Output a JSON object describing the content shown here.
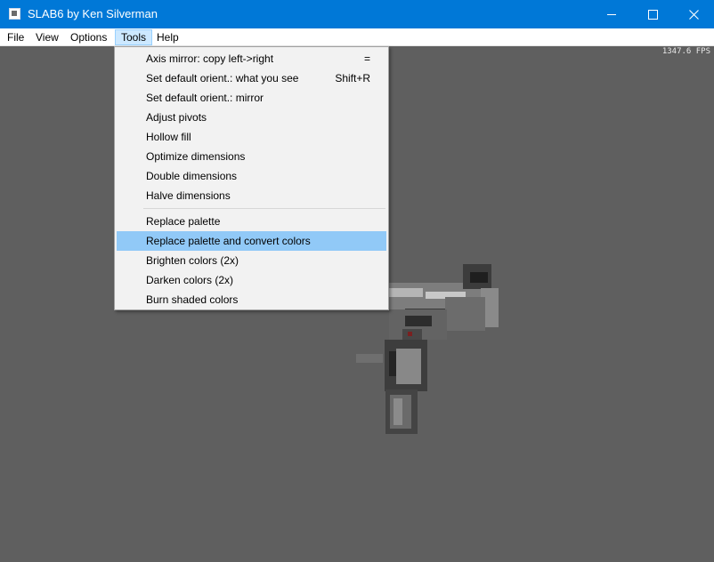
{
  "window": {
    "title": "SLAB6 by Ken Silverman"
  },
  "menubar": [
    {
      "label": "File"
    },
    {
      "label": "View"
    },
    {
      "label": "Options"
    },
    {
      "label": "Tools"
    },
    {
      "label": "Help"
    }
  ],
  "fps": "1347.6 FPS",
  "tools_menu": {
    "items": [
      {
        "label": "Axis mirror: copy left->right",
        "shortcut": "="
      },
      {
        "label": "Set default orient.: what you see",
        "shortcut": "Shift+R"
      },
      {
        "label": "Set default orient.: mirror",
        "shortcut": ""
      },
      {
        "label": "Adjust pivots",
        "shortcut": ""
      },
      {
        "label": "Hollow fill",
        "shortcut": ""
      },
      {
        "label": "Optimize dimensions",
        "shortcut": ""
      },
      {
        "label": "Double dimensions",
        "shortcut": ""
      },
      {
        "label": "Halve dimensions",
        "shortcut": ""
      },
      {
        "label": "Replace palette",
        "shortcut": ""
      },
      {
        "label": "Replace palette and convert colors",
        "shortcut": ""
      },
      {
        "label": "Brighten colors (2x)",
        "shortcut": ""
      },
      {
        "label": "Darken colors (2x)",
        "shortcut": ""
      },
      {
        "label": "Burn shaded colors",
        "shortcut": ""
      }
    ]
  },
  "colors": {
    "titlebar": "#0078d7",
    "viewport": "#5f5f5f",
    "menu_highlight": "#91c9f7"
  }
}
